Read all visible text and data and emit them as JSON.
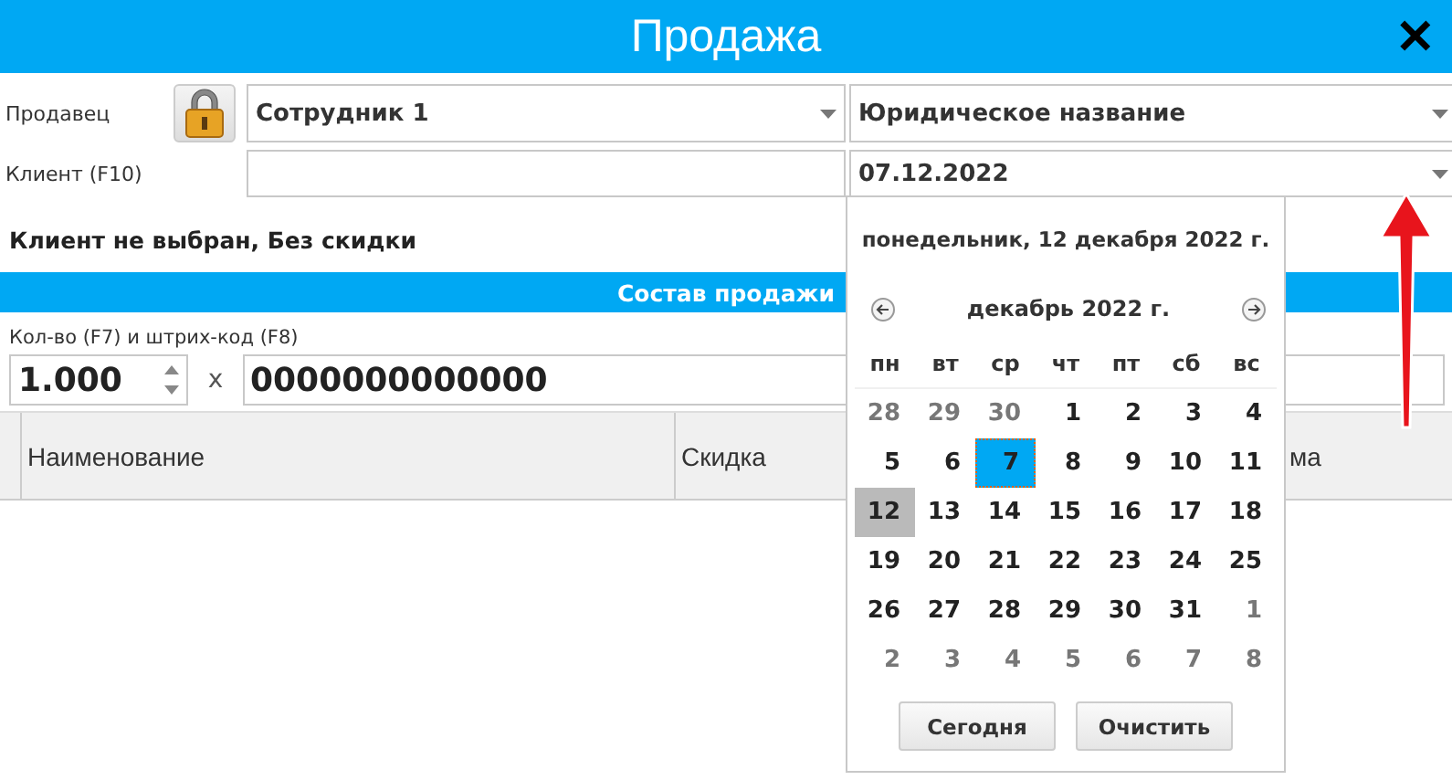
{
  "window": {
    "title": "Продажа",
    "close": "✕"
  },
  "seller": {
    "label": "Продавец",
    "value": "Сотрудник 1"
  },
  "legal_name": {
    "value": "Юридическое название"
  },
  "client": {
    "label": "Клиент (F10)"
  },
  "date": {
    "value": "07.12.2022"
  },
  "client_status": "Клиент не выбран, Без скидки",
  "section_title": "Состав продажи",
  "quantity": {
    "label": "Кол-во (F7) и штрих-код (F8)",
    "value": "1.000",
    "times": "x",
    "barcode": "0000000000000"
  },
  "table": {
    "columns": [
      {},
      {
        "label": "Наименование"
      },
      {
        "label": "Скидка"
      },
      {
        "label": "ма"
      }
    ]
  },
  "calendar": {
    "today_text": "понедельник, 12 декабря 2022 г.",
    "month": "декабрь 2022 г.",
    "weekdays": [
      "пн",
      "вт",
      "ср",
      "чт",
      "пт",
      "сб",
      "вс"
    ],
    "days": [
      {
        "label": "28",
        "outside": true,
        "selected": false,
        "today": false
      },
      {
        "label": "29",
        "outside": true,
        "selected": false,
        "today": false
      },
      {
        "label": "30",
        "outside": true,
        "selected": false,
        "today": false
      },
      {
        "label": "1",
        "outside": false,
        "selected": false,
        "today": false
      },
      {
        "label": "2",
        "outside": false,
        "selected": false,
        "today": false
      },
      {
        "label": "3",
        "outside": false,
        "selected": false,
        "today": false
      },
      {
        "label": "4",
        "outside": false,
        "selected": false,
        "today": false
      },
      {
        "label": "5",
        "outside": false,
        "selected": false,
        "today": false
      },
      {
        "label": "6",
        "outside": false,
        "selected": false,
        "today": false
      },
      {
        "label": "7",
        "outside": false,
        "selected": true,
        "today": false
      },
      {
        "label": "8",
        "outside": false,
        "selected": false,
        "today": false
      },
      {
        "label": "9",
        "outside": false,
        "selected": false,
        "today": false
      },
      {
        "label": "10",
        "outside": false,
        "selected": false,
        "today": false
      },
      {
        "label": "11",
        "outside": false,
        "selected": false,
        "today": false
      },
      {
        "label": "12",
        "outside": false,
        "selected": false,
        "today": true
      },
      {
        "label": "13",
        "outside": false,
        "selected": false,
        "today": false
      },
      {
        "label": "14",
        "outside": false,
        "selected": false,
        "today": false
      },
      {
        "label": "15",
        "outside": false,
        "selected": false,
        "today": false
      },
      {
        "label": "16",
        "outside": false,
        "selected": false,
        "today": false
      },
      {
        "label": "17",
        "outside": false,
        "selected": false,
        "today": false
      },
      {
        "label": "18",
        "outside": false,
        "selected": false,
        "today": false
      },
      {
        "label": "19",
        "outside": false,
        "selected": false,
        "today": false
      },
      {
        "label": "20",
        "outside": false,
        "selected": false,
        "today": false
      },
      {
        "label": "21",
        "outside": false,
        "selected": false,
        "today": false
      },
      {
        "label": "22",
        "outside": false,
        "selected": false,
        "today": false
      },
      {
        "label": "23",
        "outside": false,
        "selected": false,
        "today": false
      },
      {
        "label": "24",
        "outside": false,
        "selected": false,
        "today": false
      },
      {
        "label": "25",
        "outside": false,
        "selected": false,
        "today": false
      },
      {
        "label": "26",
        "outside": false,
        "selected": false,
        "today": false
      },
      {
        "label": "27",
        "outside": false,
        "selected": false,
        "today": false
      },
      {
        "label": "28",
        "outside": false,
        "selected": false,
        "today": false
      },
      {
        "label": "29",
        "outside": false,
        "selected": false,
        "today": false
      },
      {
        "label": "30",
        "outside": false,
        "selected": false,
        "today": false
      },
      {
        "label": "31",
        "outside": false,
        "selected": false,
        "today": false
      },
      {
        "label": "1",
        "outside": true,
        "selected": false,
        "today": false
      },
      {
        "label": "2",
        "outside": true,
        "selected": false,
        "today": false
      },
      {
        "label": "3",
        "outside": true,
        "selected": false,
        "today": false
      },
      {
        "label": "4",
        "outside": true,
        "selected": false,
        "today": false
      },
      {
        "label": "5",
        "outside": true,
        "selected": false,
        "today": false
      },
      {
        "label": "6",
        "outside": true,
        "selected": false,
        "today": false
      },
      {
        "label": "7",
        "outside": true,
        "selected": false,
        "today": false
      },
      {
        "label": "8",
        "outside": true,
        "selected": false,
        "today": false
      }
    ],
    "buttons": [
      "Сегодня",
      "Очистить"
    ]
  }
}
